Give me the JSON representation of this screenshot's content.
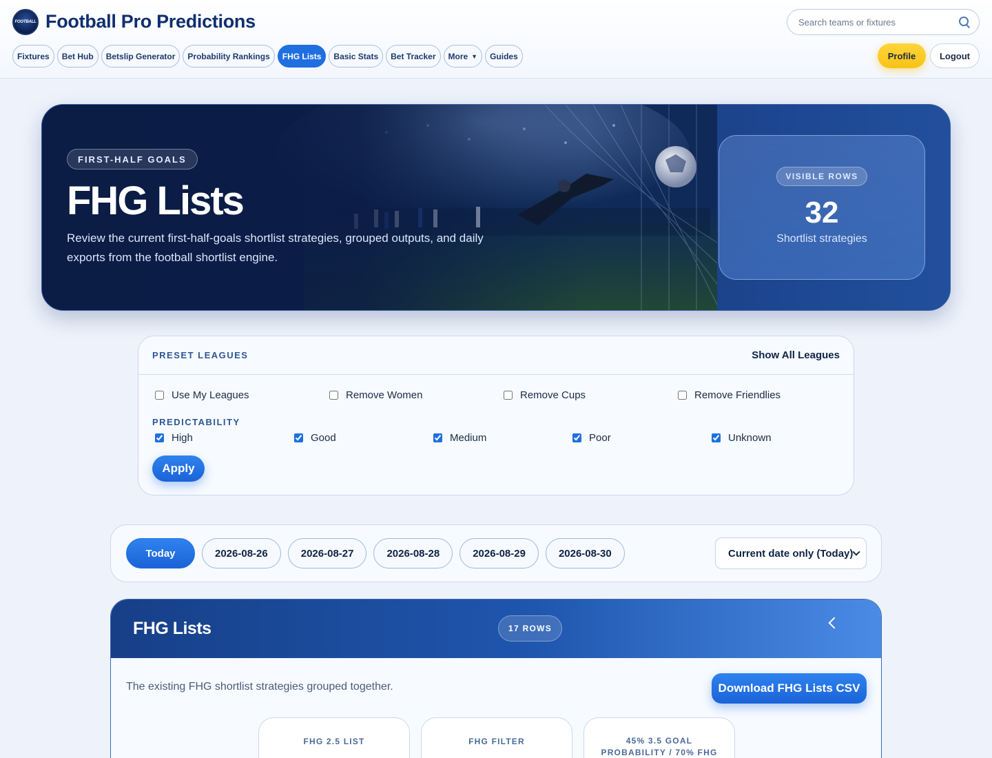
{
  "header": {
    "logo_text": "FOOTBALL",
    "brand": "Football Pro Predictions",
    "search_placeholder": "Search teams or fixtures",
    "nav": [
      {
        "label": "Fixtures",
        "active": false
      },
      {
        "label": "Bet Hub",
        "active": false
      },
      {
        "label": "Betslip Generator",
        "active": false
      },
      {
        "label": "Probability Rankings",
        "active": false
      },
      {
        "label": "FHG Lists",
        "active": true
      },
      {
        "label": "Basic Stats",
        "active": false
      },
      {
        "label": "Bet Tracker",
        "active": false
      },
      {
        "label": "More",
        "active": false
      },
      {
        "label": "Guides",
        "active": false
      }
    ],
    "profile_label": "Profile",
    "logout_label": "Logout"
  },
  "hero": {
    "tag": "FIRST-HALF GOALS",
    "title": "FHG Lists",
    "description": "Review the current first-half-goals shortlist strategies, grouped outputs, and daily exports from the football shortlist engine.",
    "stat_badge": "VISIBLE ROWS",
    "stat_value": "32",
    "stat_label": "Shortlist strategies"
  },
  "leagues": {
    "title": "PRESET LEAGUES",
    "show_all": "Show All Leagues",
    "filters": [
      {
        "label": "Use My Leagues",
        "checked": false
      },
      {
        "label": "Remove Women",
        "checked": false
      },
      {
        "label": "Remove Cups",
        "checked": false
      },
      {
        "label": "Remove Friendlies",
        "checked": false
      }
    ],
    "predictability_title": "PREDICTABILITY",
    "predictability": [
      {
        "label": "High",
        "checked": true
      },
      {
        "label": "Good",
        "checked": true
      },
      {
        "label": "Medium",
        "checked": true
      },
      {
        "label": "Poor",
        "checked": true
      },
      {
        "label": "Unknown",
        "checked": true
      }
    ],
    "apply_label": "Apply"
  },
  "dates": {
    "items": [
      "Today",
      "2026-08-26",
      "2026-08-27",
      "2026-08-28",
      "2026-08-29",
      "2026-08-30"
    ],
    "active": "Today",
    "select_value": "Current date only (Today)"
  },
  "panel": {
    "title": "FHG Lists",
    "rows_badge": "17 ROWS",
    "description": "The existing FHG shortlist strategies grouped together.",
    "download_label": "Download FHG Lists CSV",
    "cards": [
      "FHG 2.5 LIST",
      "FHG FILTER",
      "45% 3.5 GOAL PROBABILITY / 70% FHG"
    ]
  },
  "colors": {
    "accent": "#1f6fe0",
    "brand": "#0f2f6e",
    "profile": "#f7c316"
  }
}
